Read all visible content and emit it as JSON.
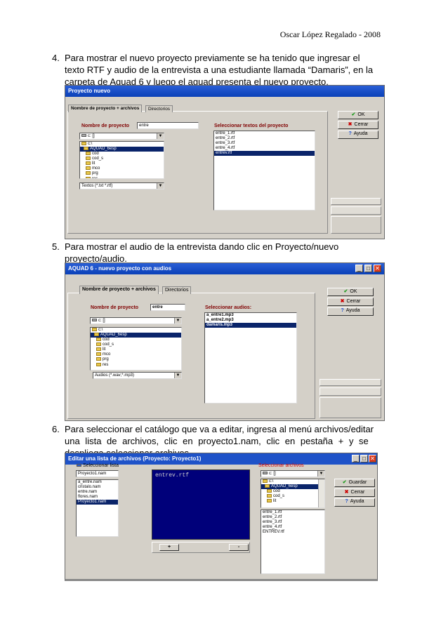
{
  "header": {
    "author": "Oscar López Regalado - 2008"
  },
  "steps": [
    {
      "num": "4.",
      "lines": [
        "Para mostrar el nuevo proyecto previamente se ha tenido que ingresar el",
        "texto RTF y audio de la entrevista a una estudiante llamada “Damaris”, en la",
        "carpeta de Aguad 6 y luego el aguad presenta el nuevo proyecto."
      ]
    },
    {
      "num": "5.",
      "lines": [
        "Para mostrar el audio de la entrevista dando clic en Proyecto/nuevo",
        "proyecto/audio."
      ]
    },
    {
      "num": "6.",
      "lines": [
        "Para seleccionar el catálogo que va a editar, ingresa al menú archivos/editar",
        "una lista de archivos, clic en proyecto1.nam, clic en pestaña + y se",
        "despliega seleccionar archivos."
      ]
    }
  ],
  "win1": {
    "title": "Proyecto nuevo",
    "tabs": [
      "Nombre de proyecto + archivos",
      "Directorios"
    ],
    "name_label": "Nombre de proyecto",
    "name_value": "entre",
    "drive": "c: []",
    "folders": [
      "c:\\",
      "AQUAD_6esp",
      "cod",
      "cod_s",
      "lit",
      "mco",
      "prg",
      "res"
    ],
    "filter": "Textos (*.txt *.rtf)",
    "files_label": "Seleccionar textos del proyecto",
    "files": [
      "entre_1.rtf",
      "entre_2.rtf",
      "entre_3.rtf",
      "entre_4.rtf",
      "entrev.rtf"
    ],
    "ok": "OK",
    "cancel": "Cerrar",
    "help": "Ayuda"
  },
  "win2": {
    "title": "AQUAD 6 - nuevo proyecto con audios",
    "tabs": [
      "Nombre de proyecto + archivos",
      "Directorios"
    ],
    "name_label": "Nombre de proyecto",
    "name_value": "entre",
    "drive": "c: []",
    "folders": [
      "c:\\",
      "AQUAD_6esp",
      "cod",
      "cod_s",
      "lit",
      "mco",
      "prg",
      "res"
    ],
    "filter": "Audios (*.wav;*.mp3)",
    "files_label": "Seleccionar audios:",
    "files": [
      "a_entre1.mp3",
      "a_entre2.mp3",
      "damaris.mp3"
    ],
    "ok": "OK",
    "cancel": "Cerrar",
    "help": "Ayuda"
  },
  "win3": {
    "title": "Editar una lista de archivos (Proyecto: Proyecto1)",
    "select_list_label": "Seleccionar lista",
    "list_value": "Proyecto1.nam",
    "lists": [
      "a_entre.nam",
      "cristalo.nam",
      "entre.nam",
      "flores.nam",
      "Proyecto1.nam"
    ],
    "editor_text": "entrev.rtf",
    "plus": "+",
    "minus": "-",
    "select_files_label": "Seleccionar archivos",
    "drive": "c: []",
    "folders": [
      "c:\\",
      "AQUAD_6esp",
      "cod",
      "cod_s",
      "lit"
    ],
    "files": [
      "entre_1.rtf",
      "entre_2.rtf",
      "entre_3.rtf",
      "entre_4.rtf",
      "ENTREV.rtf"
    ],
    "save": "Guardar",
    "cancel": "Cerrar",
    "help": "Ayuda"
  }
}
